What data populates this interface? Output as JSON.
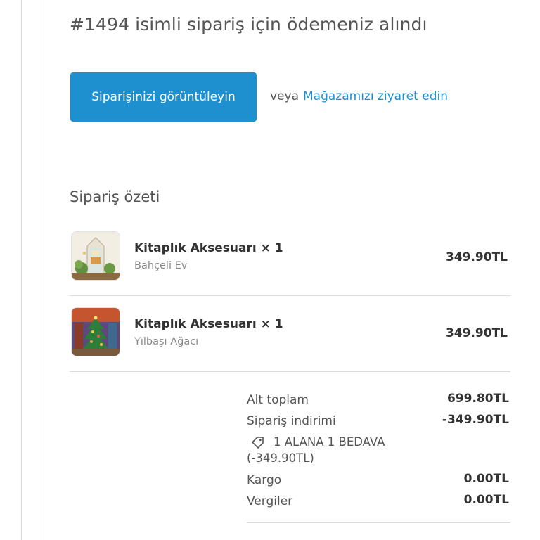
{
  "header": {
    "title": "#1494 isimli sipariş için ödemeniz alındı"
  },
  "actions": {
    "view_order_label": "Siparişinizi görüntüleyin",
    "or_text": "veya",
    "visit_store_label": "Mağazamızı ziyaret edin"
  },
  "summary": {
    "title": "Sipariş özeti",
    "items": [
      {
        "name": "Kitaplık Aksesuarı × 1",
        "variant": "Bahçeli Ev",
        "price": "349.90TL",
        "thumbnail_icon": "garden-house-book-nook-icon"
      },
      {
        "name": "Kitaplık Aksesuarı × 1",
        "variant": "Yılbaşı Ağacı",
        "price": "349.90TL",
        "thumbnail_icon": "christmas-tree-book-nook-icon"
      }
    ]
  },
  "totals": {
    "subtotal_label": "Alt toplam",
    "subtotal_value": "699.80TL",
    "discount_label": "Sipariş indirimi",
    "discount_value": "-349.90TL",
    "discount_code": "1 ALANA 1 BEDAVA",
    "discount_code_amount": "(-349.90TL)",
    "shipping_label": "Kargo",
    "shipping_value": "0.00TL",
    "tax_label": "Vergiler",
    "tax_value": "0.00TL"
  },
  "colors": {
    "accent": "#1e90cf",
    "text": "#333333",
    "muted": "#888888",
    "divider": "#dcdcdc"
  }
}
